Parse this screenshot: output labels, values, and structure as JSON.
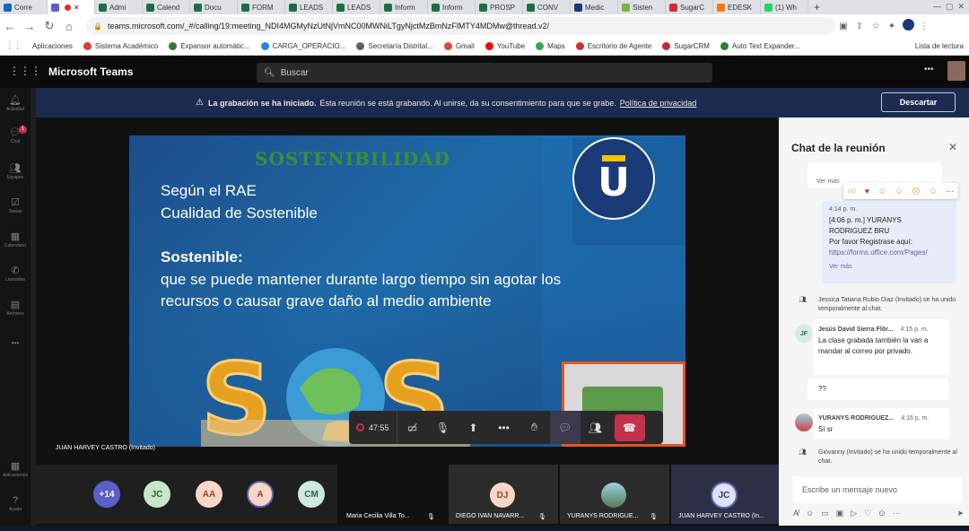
{
  "browser": {
    "tabs": [
      {
        "label": "Corre",
        "color": "#0f6cbd"
      },
      {
        "label": "",
        "color": "#5b5fc7"
      },
      {
        "label": "Admi",
        "color": "#1d6f42"
      },
      {
        "label": "Calend",
        "color": "#1d6f42"
      },
      {
        "label": "Docu",
        "color": "#1d6f42"
      },
      {
        "label": "FORM",
        "color": "#1d6f42"
      },
      {
        "label": "LEADS",
        "color": "#1d6f42"
      },
      {
        "label": "LEADS",
        "color": "#1d6f42"
      },
      {
        "label": "Inform",
        "color": "#1d6f42"
      },
      {
        "label": "Inform",
        "color": "#1d6f42"
      },
      {
        "label": "PROSP",
        "color": "#1d6f42"
      },
      {
        "label": "CONV",
        "color": "#1d6f42"
      },
      {
        "label": "Medic",
        "color": "#1a3a78"
      },
      {
        "label": "Sisten",
        "color": "#7cb342"
      },
      {
        "label": "SugarC",
        "color": "#d32f2f"
      },
      {
        "label": "EDESK",
        "color": "#f57c00"
      },
      {
        "label": "(1) Wh",
        "color": "#25d366"
      }
    ],
    "url": "teams.microsoft.com/_#/calling/19:meeting_NDI4MGMyNzUtNjVmNC00MWNiLTgyNjctMzBmNzFlMTY4MDMw@thread.v2/",
    "bookmarks": [
      {
        "label": "Aplicaciones",
        "color": "#ea4335"
      },
      {
        "label": "Sistema Académico",
        "color": "#e53935"
      },
      {
        "label": "Expansor automátic...",
        "color": "#2e7d32"
      },
      {
        "label": "CARGA_OPERACIO...",
        "color": "#1e88e5"
      },
      {
        "label": "Secretaría Distrital...",
        "color": "#616161"
      },
      {
        "label": "Gmail",
        "color": "#ea4335"
      },
      {
        "label": "YouTube",
        "color": "#ff0000"
      },
      {
        "label": "Maps",
        "color": "#34a853"
      },
      {
        "label": "Escritorio de Agente",
        "color": "#d32f2f"
      },
      {
        "label": "SugarCRM",
        "color": "#c62828"
      },
      {
        "label": "Auto Text Expander...",
        "color": "#2e7d32"
      }
    ],
    "reading_list": "Lista de lectura"
  },
  "teams": {
    "app_name": "Microsoft Teams",
    "search_placeholder": "Buscar",
    "rail": [
      "Actividad",
      "Chat",
      "Equipos",
      "Tareas",
      "Calendario",
      "Llamadas",
      "Archivos",
      "Aplicaciones",
      "Ayuda"
    ],
    "chat_badge": "1",
    "banner": {
      "bold": "La grabación se ha iniciado.",
      "text": "Esta reunión se está grabando. Al unirse, da su consentimiento para que se grabe.",
      "link": "Política de privacidad",
      "button": "Descartar"
    }
  },
  "slide": {
    "title": "SOSTENIBILIDAD",
    "line1": "Según el RAE",
    "line2": "Cualidad de Sostenible",
    "heading": "Sostenible:",
    "line3": "que se puede mantener durante largo tiempo sin agotar los",
    "line4": "recursos o causar grave daño al medio ambiente",
    "logo_letter": "U"
  },
  "presenter": "JUAN HARVEY CASTRO (Invitado)",
  "controls": {
    "timer": "47:55"
  },
  "participants": {
    "overflow": "+14",
    "avatars": [
      {
        "initials": "JC",
        "bg": "#c8e6c9",
        "fg": "#2e5e2e"
      },
      {
        "initials": "AA",
        "bg": "#f8d7c8",
        "fg": "#8a4a2a"
      },
      {
        "initials": "A",
        "bg": "#f8d7c8",
        "fg": "#8a4a2a"
      },
      {
        "initials": "CM",
        "bg": "#cfe8e0",
        "fg": "#2e5e52"
      }
    ],
    "tiles": [
      {
        "name": "Maria Cecilia Villa To..."
      },
      {
        "name": "DIEGO IVAN NAVARR...",
        "initials": "DJ"
      },
      {
        "name": "YURANYS RODRIGUE..."
      },
      {
        "name": "JUAN HARVEY CASTRO (In...",
        "initials": "JC"
      }
    ]
  },
  "chat": {
    "title": "Chat de la reunión",
    "see_more": "Ver más",
    "msg1": {
      "time": "4:14 p. m.",
      "lines": [
        "[4:06 p. m.] YURANYS",
        "RODRIGUEZ BRU",
        "Por favor Registrase aquí:",
        "https://forms.office.com/Pages/"
      ]
    },
    "event1": {
      "name": "Jessica Tatiana Rubio Diaz (Invitado)",
      "text": "se ha unido temporalmente al chat."
    },
    "msg2": {
      "author": "Jesús David Sierra Flór...",
      "time": "4:15 p. m.",
      "initials": "JF",
      "text": "La clase grabada también la van a mandar al correo por privado."
    },
    "msg3": {
      "text": "??"
    },
    "msg4": {
      "author": "YURANYS RODRIGUEZ...",
      "time": "4:16 p. m.",
      "text": "Sí sr"
    },
    "event2": {
      "name": "Giovanny (Invitado)",
      "text": "se ha unido temporalmente al chat."
    },
    "compose_placeholder": "Escribe un mensaje nuevo"
  },
  "colors": {
    "accent": "#6264a7",
    "hangup": "#c4314b",
    "banner": "#1b2a4e",
    "slide_title": "#3a8f3a"
  }
}
